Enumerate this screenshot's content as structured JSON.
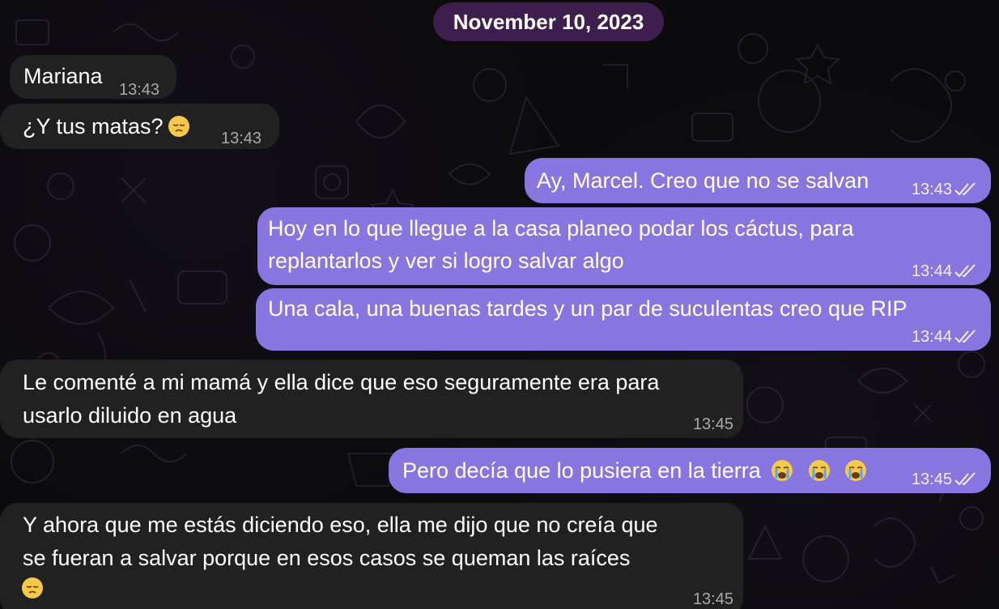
{
  "date_header": "November 10, 2023",
  "messages": [
    {
      "text": "Mariana",
      "time": "13:43"
    },
    {
      "text": "¿Y tus matas?",
      "time": "13:43",
      "emoji": "pensive-face-icon"
    },
    {
      "text": "Ay, Marcel. Creo que no se salvan",
      "time": "13:43"
    },
    {
      "line1": "Hoy en lo que llegue a la casa planeo podar los cáctus, para",
      "line2": "replantarlos y ver si logro salvar algo",
      "time": "13:44"
    },
    {
      "text": "Una cala, una buenas tardes y un par de suculentas creo que RIP",
      "time": "13:44"
    },
    {
      "line1": "Le comenté a mi mamá y ella dice que eso seguramente era para",
      "line2": "usarlo diluido en agua",
      "time": "13:45"
    },
    {
      "text": "Pero decía que lo pusiera en la tierra",
      "time": "13:45",
      "emoji": "loudly-crying-face-icon",
      "emoji_count": 3
    },
    {
      "line1": "Y ahora que me estás diciendo eso, ella me dijo que no creía que",
      "line2": "se fueran a salvar porque en esos casos se queman las raíces",
      "time": "13:45",
      "emoji": "pensive-face-icon"
    }
  ],
  "colors": {
    "background": "#0b0b0d",
    "incoming_bubble": "#212121",
    "outgoing_bubble": "#8776df",
    "date_pill": "#3d1e4f"
  }
}
